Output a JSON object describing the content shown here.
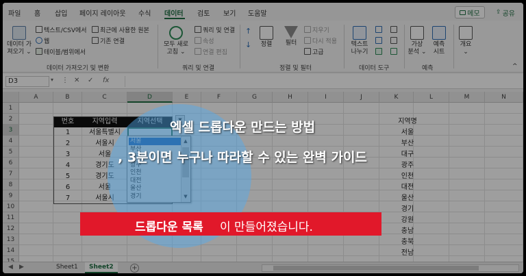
{
  "menu": {
    "tabs": [
      "파일",
      "홈",
      "삽입",
      "페이지 레이아웃",
      "수식",
      "데이터",
      "검토",
      "보기",
      "도움말"
    ],
    "active_tab": "데이터",
    "memo_label": "메모",
    "share_label": "공유"
  },
  "ribbon": {
    "get_data": {
      "label_line1": "데이터 가",
      "label_line2": "져오기"
    },
    "text_csv": "텍스트/CSV에서",
    "web": "웹",
    "table_range": "테이블/범위에서",
    "recent_sources": "최근에 사용한 원본",
    "existing_connections": "기존 연결",
    "group_get_transform": "데이터 가져오기 및 변환",
    "refresh_all": {
      "line1": "모두 새로",
      "line2": "고침"
    },
    "queries_connections": "쿼리 및 연결",
    "properties": "속성",
    "edit_links": "연결 편집",
    "group_queries": "쿼리 및 연결",
    "sort_asc": "↑",
    "sort_desc": "↓",
    "sort": "정렬",
    "filter": "필터",
    "clear": "지우기",
    "reapply": "다시 적용",
    "advanced": "고급",
    "group_sort_filter": "정렬 및 필터",
    "text_to_columns": {
      "line1": "텍스트",
      "line2": "나누기"
    },
    "group_data_tools": "데이터 도구",
    "what_if": {
      "line1": "가상",
      "line2": "분석"
    },
    "forecast_sheet": {
      "line1": "예측",
      "line2": "시트"
    },
    "group_forecast": "예측",
    "outline": "개요"
  },
  "formula_bar": {
    "name_box": "D3",
    "cancel": "✕",
    "enter": "✓",
    "fx": "fx",
    "value": ""
  },
  "grid": {
    "columns": [
      "A",
      "B",
      "C",
      "D",
      "E",
      "F",
      "G",
      "H",
      "I",
      "J",
      "K",
      "L",
      "M",
      "N"
    ],
    "selected_column": "D",
    "rows": [
      "1",
      "2",
      "3",
      "4",
      "5",
      "6",
      "7",
      "8",
      "9",
      "10",
      "11",
      "12",
      "13",
      "14",
      "15"
    ],
    "table_headers": {
      "no": "번호",
      "region_input": "지역입력",
      "region_select": "지역선택"
    },
    "table_rows": [
      {
        "no": "1",
        "region": "서울특별시"
      },
      {
        "no": "2",
        "region": "서울시"
      },
      {
        "no": "3",
        "region": "서울"
      },
      {
        "no": "4",
        "region": "경기도"
      },
      {
        "no": "5",
        "region": "경기도"
      },
      {
        "no": "6",
        "region": "서울"
      },
      {
        "no": "7",
        "region": "서울시"
      }
    ],
    "region_list": [
      "지역명",
      "서울",
      "부산",
      "대구",
      "광주",
      "인천",
      "대전",
      "울산",
      "경기",
      "강원",
      "충남",
      "충북",
      "전남"
    ]
  },
  "dropdown": {
    "items": [
      "서울",
      "부산",
      "대구",
      "광주",
      "인천",
      "대전",
      "울산",
      "경기"
    ],
    "selected": "서울",
    "scroll_up": "▲",
    "scroll_down": "▼",
    "arrow": "▼"
  },
  "sheets": {
    "tabs": [
      "Sheet1",
      "Sheet2"
    ],
    "active": "Sheet2",
    "add_label": "+"
  },
  "overlay": {
    "title_line1": "엑셀 드롭다운 만드는 방법",
    "title_line2": ", 3분이면 누구나 따라할 수 있는 완벽 가이드",
    "banner_bold": "드롭다운 목록",
    "banner_rest": "이 만들어졌습니다.",
    "banner_color": "#e1182a",
    "spotlight_color": "#50aaf0"
  }
}
